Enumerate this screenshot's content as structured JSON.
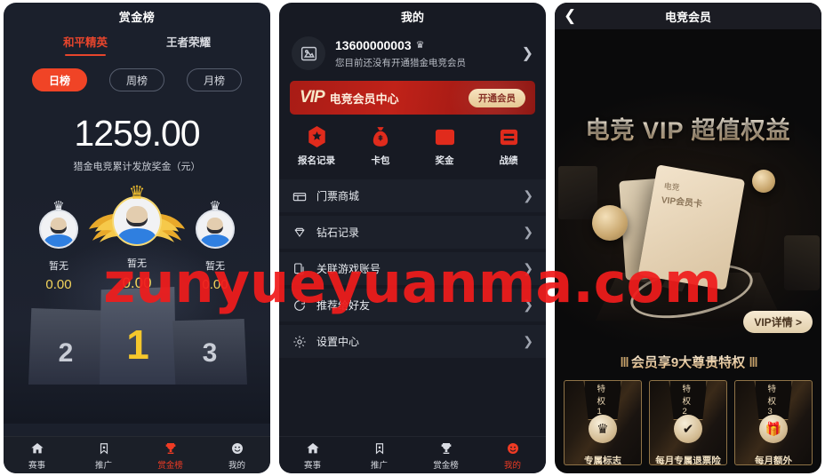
{
  "watermark": {
    "text": "zunyueyuanma.com",
    "color": "#f01c1c"
  },
  "panel_ranking": {
    "title": "赏金榜",
    "game_tabs": [
      {
        "label": "和平精英",
        "active": true
      },
      {
        "label": "王者荣耀",
        "active": false
      }
    ],
    "period_pills": [
      {
        "label": "日榜",
        "active": true
      },
      {
        "label": "周榜",
        "active": false
      },
      {
        "label": "月榜",
        "active": false
      }
    ],
    "total_amount": "1259.00",
    "total_caption": "猎金电竞累计发放奖金（元）",
    "podium": [
      {
        "rank": "2",
        "name": "暂无",
        "score": "0.00"
      },
      {
        "rank": "1",
        "name": "暂无",
        "score": "0.00"
      },
      {
        "rank": "3",
        "name": "暂无",
        "score": "0.00"
      }
    ],
    "tabbar": [
      {
        "label": "赛事",
        "icon": "home-icon",
        "active": false
      },
      {
        "label": "推广",
        "icon": "bookmark-star-icon",
        "active": false
      },
      {
        "label": "赏金榜",
        "icon": "trophy-icon",
        "active": true
      },
      {
        "label": "我的",
        "icon": "smiley-icon",
        "active": false
      }
    ]
  },
  "panel_mine": {
    "title": "我的",
    "user": {
      "phone": "13600000003",
      "crown_badge": "♛",
      "subtitle": "您目前还没有开通猎金电竞会员",
      "chevron": "❯"
    },
    "vip_banner": {
      "logo": "VIP",
      "text": "电竞会员中心",
      "button": "开通会员"
    },
    "quick_actions": [
      {
        "label": "报名记录",
        "icon": "hex-star-icon"
      },
      {
        "label": "卡包",
        "icon": "money-bag-icon"
      },
      {
        "label": "奖金",
        "icon": "wallet-icon"
      },
      {
        "label": "战绩",
        "icon": "list-icon"
      }
    ],
    "menu": [
      {
        "label": "门票商城",
        "icon": "store-icon",
        "chevron": "❯"
      },
      {
        "label": "钻石记录",
        "icon": "diamond-icon",
        "chevron": "❯"
      },
      {
        "label": "关联游戏账号",
        "icon": "link-game-icon",
        "chevron": "❯"
      },
      {
        "label": "推荐给好友",
        "icon": "share-refresh-icon",
        "chevron": "❯"
      },
      {
        "label": "设置中心",
        "icon": "gear-icon",
        "chevron": "❯"
      }
    ],
    "tabbar": [
      {
        "label": "赛事",
        "icon": "home-icon",
        "active": false
      },
      {
        "label": "推广",
        "icon": "bookmark-star-icon",
        "active": false
      },
      {
        "label": "赏金榜",
        "icon": "trophy-icon",
        "active": false
      },
      {
        "label": "我的",
        "icon": "smiley-icon",
        "active": true
      }
    ]
  },
  "panel_vip": {
    "title": "电竞会员",
    "back_icon": "chevron-left-icon",
    "hero_title": "电竞 VIP 超值权益",
    "card_line1": "电竞",
    "card_line2": "VIP会员卡",
    "card_ghost": "VIP",
    "detail_button": "VIP详情 >",
    "privileges_heading": "会员享9大尊贵特权",
    "heading_ornament": "Ⅲ",
    "privileges": [
      {
        "tag": "特权1",
        "icon": "crown-icon",
        "glyph": "♛",
        "label": "专属标志"
      },
      {
        "tag": "特权2",
        "icon": "shield-check-icon",
        "glyph": "✔",
        "label": "每月专属退票险"
      },
      {
        "tag": "特权3",
        "icon": "gift-icon",
        "glyph": "🎁",
        "label": "每月额外"
      }
    ]
  }
}
